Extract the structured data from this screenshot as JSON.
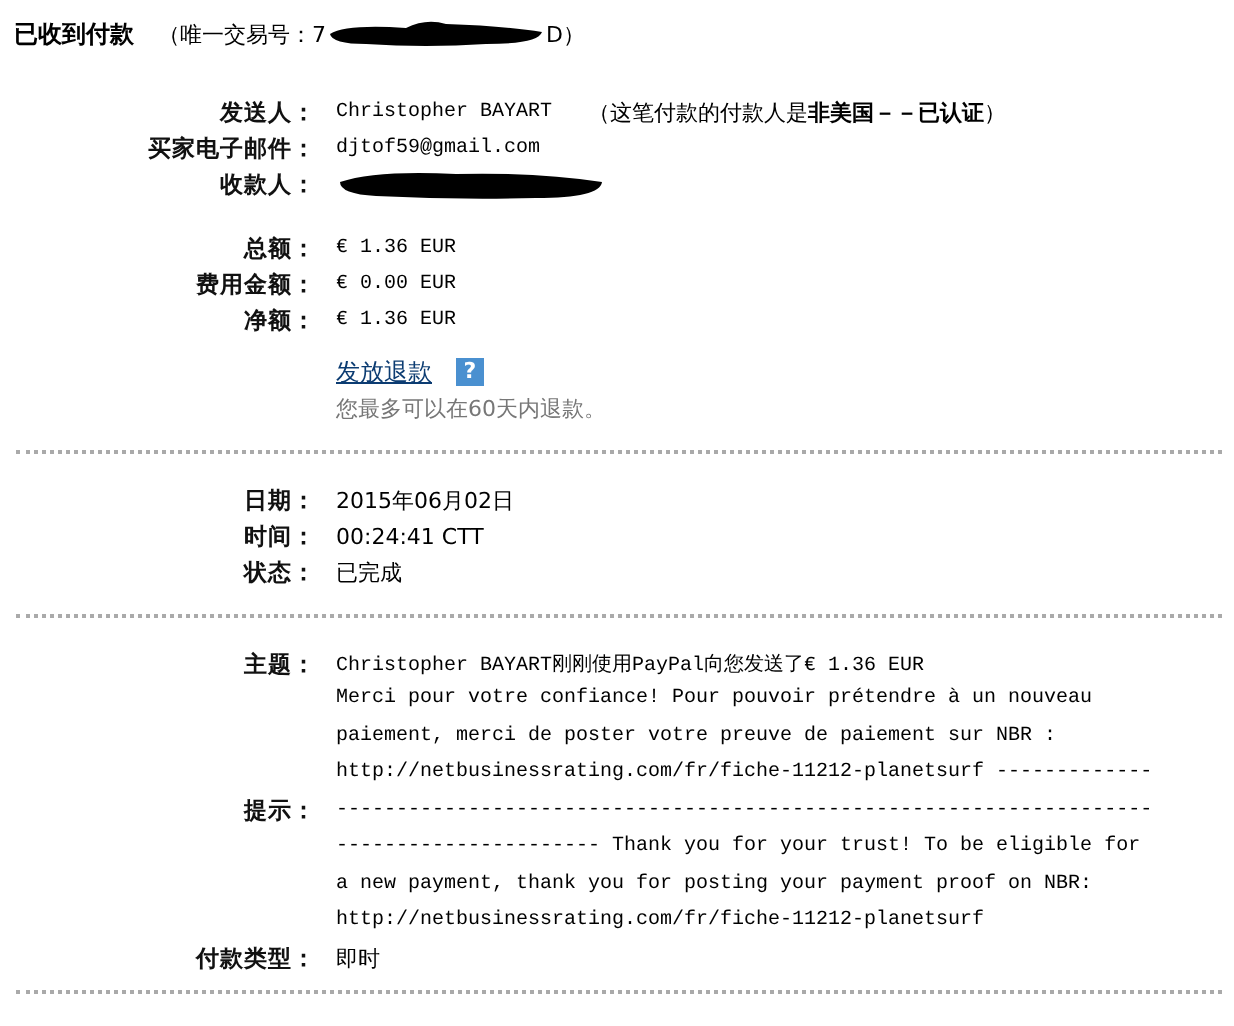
{
  "heading": {
    "title": "已收到付款",
    "txn_prefix": "（唯一交易号：7",
    "txn_suffix": "D）"
  },
  "sender": {
    "label": "发送人：",
    "value": "Christopher BAYART",
    "note": "（这笔付款的付款人是**非美国－－已认证**）"
  },
  "buyer_email": {
    "label": "买家电子邮件：",
    "value": "djtof59@gmail.com"
  },
  "recipient": {
    "label": "收款人："
  },
  "amounts": [
    {
      "label": "总额：",
      "value": "€ 1.36 EUR"
    },
    {
      "label": "费用金额：",
      "value": "€ 0.00 EUR"
    },
    {
      "label": "净额：",
      "value": "€ 1.36 EUR"
    }
  ],
  "refund": {
    "link": "发放退款",
    "help": "?",
    "note": "您最多可以在60天内退款。"
  },
  "details": [
    {
      "label": "日期：",
      "value": "2015年06月02日"
    },
    {
      "label": "时间：",
      "value": "00:24:41 CTT"
    },
    {
      "label": "状态：",
      "value": "已完成"
    }
  ],
  "subject": {
    "label": "主题：",
    "value": "Christopher BAYART刚刚使用PayPal向您发送了€ 1.36 EUR"
  },
  "memo": {
    "label": "提示：",
    "lines": [
      "Merci pour votre confiance! Pour pouvoir prétendre à un nouveau",
      "paiement, merci de poster votre preuve de paiement sur NBR :",
      "http://netbusinessrating.com/fr/fiche-11212-planetsurf -------------",
      "--------------------------------------------------------------------",
      "---------------------- Thank you for your trust! To be eligible for",
      "a new payment, thank you for posting your payment proof on NBR:",
      "http://netbusinessrating.com/fr/fiche-11212-planetsurf"
    ]
  },
  "payment_type": {
    "label": "付款类型：",
    "value": "即时"
  }
}
